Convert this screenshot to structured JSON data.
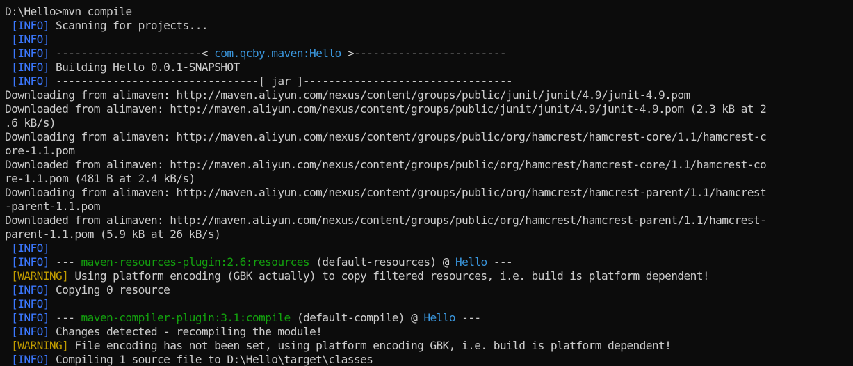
{
  "colors": {
    "background": "#0c0c0c",
    "text": "#cccccc",
    "info_label": "#3b78ff",
    "project_link": "#3a96dd",
    "plugin": "#13a10e",
    "warning_label": "#c19c00"
  },
  "lines": [
    [
      {
        "t": "D:\\Hello>mvn compile",
        "c": "txt"
      }
    ],
    [
      {
        "t": " [INFO]",
        "c": "lbl"
      },
      {
        "t": " Scanning for projects...",
        "c": "txt"
      }
    ],
    [
      {
        "t": " [INFO]",
        "c": "lbl"
      }
    ],
    [
      {
        "t": " [INFO]",
        "c": "lbl"
      },
      {
        "t": " -----------------------< ",
        "c": "txt"
      },
      {
        "t": "com.qcby.maven:Hello",
        "c": "link"
      },
      {
        "t": " >------------------------",
        "c": "txt"
      }
    ],
    [
      {
        "t": " [INFO]",
        "c": "lbl"
      },
      {
        "t": " Building Hello 0.0.1-SNAPSHOT",
        "c": "txt"
      }
    ],
    [
      {
        "t": " [INFO]",
        "c": "lbl"
      },
      {
        "t": " --------------------------------[ jar ]---------------------------------",
        "c": "txt"
      }
    ],
    [
      {
        "t": "Downloading from alimaven: http://maven.aliyun.com/nexus/content/groups/public/junit/junit/4.9/junit-4.9.pom",
        "c": "txt"
      }
    ],
    [
      {
        "t": "Downloaded from alimaven: http://maven.aliyun.com/nexus/content/groups/public/junit/junit/4.9/junit-4.9.pom (2.3 kB at 2",
        "c": "txt"
      }
    ],
    [
      {
        "t": ".6 kB/s)",
        "c": "txt"
      }
    ],
    [
      {
        "t": "Downloading from alimaven: http://maven.aliyun.com/nexus/content/groups/public/org/hamcrest/hamcrest-core/1.1/hamcrest-c",
        "c": "txt"
      }
    ],
    [
      {
        "t": "ore-1.1.pom",
        "c": "txt"
      }
    ],
    [
      {
        "t": "Downloaded from alimaven: http://maven.aliyun.com/nexus/content/groups/public/org/hamcrest/hamcrest-core/1.1/hamcrest-co",
        "c": "txt"
      }
    ],
    [
      {
        "t": "re-1.1.pom (481 B at 2.4 kB/s)",
        "c": "txt"
      }
    ],
    [
      {
        "t": "Downloading from alimaven: http://maven.aliyun.com/nexus/content/groups/public/org/hamcrest/hamcrest-parent/1.1/hamcrest",
        "c": "txt"
      }
    ],
    [
      {
        "t": "-parent-1.1.pom",
        "c": "txt"
      }
    ],
    [
      {
        "t": "Downloaded from alimaven: http://maven.aliyun.com/nexus/content/groups/public/org/hamcrest/hamcrest-parent/1.1/hamcrest-",
        "c": "txt"
      }
    ],
    [
      {
        "t": "parent-1.1.pom (5.9 kB at 26 kB/s)",
        "c": "txt"
      }
    ],
    [
      {
        "t": " [INFO]",
        "c": "lbl"
      }
    ],
    [
      {
        "t": " [INFO]",
        "c": "lbl"
      },
      {
        "t": " --- ",
        "c": "txt"
      },
      {
        "t": "maven-resources-plugin:2.6:resources",
        "c": "plug"
      },
      {
        "t": " (default-resources) @ ",
        "c": "txt"
      },
      {
        "t": "Hello",
        "c": "link"
      },
      {
        "t": " ---",
        "c": "txt"
      }
    ],
    [
      {
        "t": " [WARNING]",
        "c": "warn"
      },
      {
        "t": " Using platform encoding (GBK actually) to copy filtered resources, i.e. build is platform dependent!",
        "c": "txt"
      }
    ],
    [
      {
        "t": " [INFO]",
        "c": "lbl"
      },
      {
        "t": " Copying 0 resource",
        "c": "txt"
      }
    ],
    [
      {
        "t": " [INFO]",
        "c": "lbl"
      }
    ],
    [
      {
        "t": " [INFO]",
        "c": "lbl"
      },
      {
        "t": " --- ",
        "c": "txt"
      },
      {
        "t": "maven-compiler-plugin:3.1:compile",
        "c": "plug"
      },
      {
        "t": " (default-compile) @ ",
        "c": "txt"
      },
      {
        "t": "Hello",
        "c": "link"
      },
      {
        "t": " ---",
        "c": "txt"
      }
    ],
    [
      {
        "t": " [INFO]",
        "c": "lbl"
      },
      {
        "t": " Changes detected - recompiling the module!",
        "c": "txt"
      }
    ],
    [
      {
        "t": " [WARNING]",
        "c": "warn"
      },
      {
        "t": " File encoding has not been set, using platform encoding GBK, i.e. build is platform dependent!",
        "c": "txt"
      }
    ],
    [
      {
        "t": " [INFO]",
        "c": "lbl"
      },
      {
        "t": " Compiling 1 source file to D:\\Hello\\target\\classes",
        "c": "txt"
      }
    ]
  ]
}
